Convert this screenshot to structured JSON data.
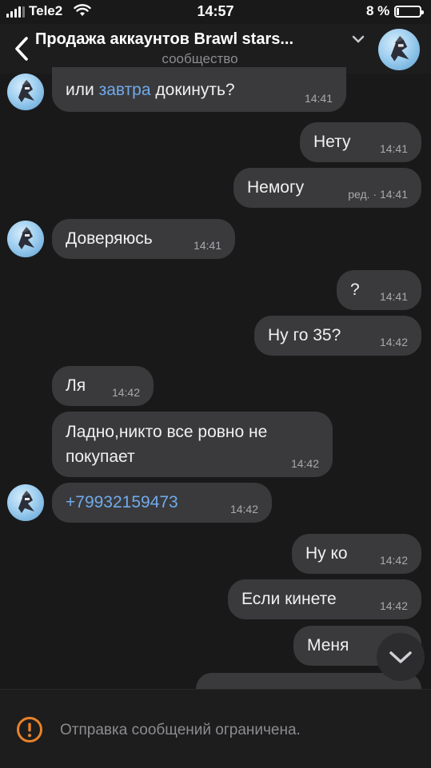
{
  "status_bar": {
    "carrier": "Tele2",
    "time": "14:57",
    "battery_percent": "8 %"
  },
  "header": {
    "title": "Продажа аккаунтов Brawl stars...",
    "subtitle": "сообщество"
  },
  "messages": [
    {
      "side": "in",
      "link": "завтра",
      "pre": "или ",
      "post": " докинуть?",
      "time": "14:41"
    },
    {
      "side": "out",
      "text": "Нету",
      "time": "14:41"
    },
    {
      "side": "out",
      "text": "Немогу",
      "edited": "ред. · ",
      "time": "14:41"
    },
    {
      "side": "in",
      "text": "Доверяюсь",
      "time": "14:41"
    },
    {
      "side": "out",
      "text": "?",
      "time": "14:41"
    },
    {
      "side": "out",
      "text": "Ну го 35?",
      "time": "14:42"
    },
    {
      "side": "in",
      "text": "Ля",
      "time": "14:42"
    },
    {
      "side": "in",
      "text": "Ладно,никто все ровно не покупает",
      "time": "14:42"
    },
    {
      "side": "in",
      "text": "+79932159473",
      "time": "14:42"
    },
    {
      "side": "out",
      "text": "Ну ко",
      "time": "14:42"
    },
    {
      "side": "out",
      "text": "Если кинете",
      "time": "14:42"
    },
    {
      "side": "out",
      "text": "Меня",
      "time": ""
    }
  ],
  "footer": {
    "notice": "Отправка сообщений ограничена."
  },
  "colors": {
    "background": "#19191a",
    "bubble": "#3a3a3c",
    "link": "#71aaeb",
    "warning": "#e8822a"
  }
}
